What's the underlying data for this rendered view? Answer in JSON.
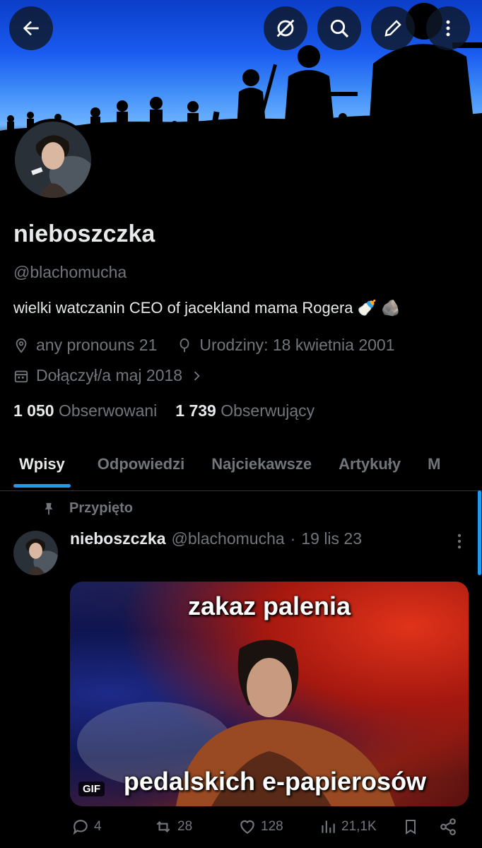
{
  "header": {
    "back_icon": "arrow-left-icon",
    "actions": [
      "spaces-off-icon",
      "search-icon",
      "edit-icon",
      "more-vertical-icon"
    ]
  },
  "profile": {
    "display_name": "nieboszczka",
    "handle": "@blachomucha",
    "bio": "wielki watczanin CEO of jacekland mama Rogera",
    "bio_emojis": [
      "🍼",
      "🪨"
    ],
    "pronouns": "any pronouns 21",
    "birthday": "Urodziny: 18 kwietnia 2001",
    "joined": "Dołączył/a maj 2018",
    "following_count": "1 050",
    "following_label": "Obserwowani",
    "followers_count": "1 739",
    "followers_label": "Obserwujący"
  },
  "tabs": [
    {
      "label": "Wpisy",
      "active": true
    },
    {
      "label": "Odpowiedzi",
      "active": false
    },
    {
      "label": "Najciekawsze",
      "active": false
    },
    {
      "label": "Artykuły",
      "active": false
    },
    {
      "label": "M",
      "active": false
    }
  ],
  "post": {
    "pinned_label": "Przypięto",
    "author": "nieboszczka",
    "handle": "@blachomucha",
    "separator": "·",
    "date": "19 lis 23",
    "media_caption_top": "zakaz palenia",
    "media_caption_bottom": "pedalskich e-papierosów",
    "media_badge": "GIF",
    "replies": "4",
    "reposts": "28",
    "likes": "128",
    "views": "21,1K"
  },
  "colors": {
    "background": "#000000",
    "text": "#e7e9ea",
    "muted": "#71767b",
    "accent": "#1d9bf0",
    "divider": "#2f3336"
  }
}
